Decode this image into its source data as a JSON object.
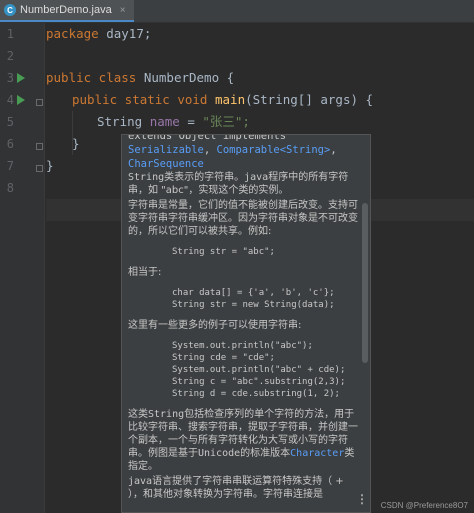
{
  "tab": {
    "title": "NumberDemo.java",
    "icon": "class-icon",
    "close": "×"
  },
  "gutter": {
    "line_numbers": [
      "1",
      "2",
      "3",
      "4",
      "5",
      "6",
      "7",
      "8"
    ]
  },
  "code": {
    "l1_kw": "package",
    "l1_rest": " day17;",
    "l3_kw": "public class",
    "l3_rest": " NumberDemo {",
    "l4_kw": "public static void",
    "l4_fn": "main",
    "l4_rest": "(String[] args) {",
    "l5_type": "String",
    "l5_var": "name",
    "l5_eq": " = ",
    "l5_str": "\"张三\";",
    "l6": "}",
    "l7": "}"
  },
  "doc": {
    "sig_line0": "extends Object implements",
    "sig_line1a": "Serializable",
    "sig_line1b": ", ",
    "sig_line1c": "Comparable<String>",
    "sig_line1d": ",",
    "sig_line2": "CharSequence",
    "p1a": "String",
    "p1b": "类表示的字符串。",
    "p1c": "java",
    "p1d": "程序中的所有字符串，如 \"abc\"，实现这个类的实例。",
    "p2": "字符串是常量，它们的值不能被创建后改变。支持可变字符串字符串缓冲区。因为字符串对象是不可改变的，所以它们可以被共享。例如:",
    "code1": "String str = \"abc\";",
    "p3": "相当于:",
    "code2": "char data[] = {'a', 'b', 'c'};\nString str = new String(data);",
    "p4": "这里有一些更多的例子可以使用字符串:",
    "code3": "System.out.println(\"abc\");\nString cde = \"cde\";\nSystem.out.println(\"abc\" + cde);\nString c = \"abc\".substring(2,3);\nString d = cde.substring(1, 2);",
    "p5a": "这类",
    "p5b": "String",
    "p5c": "包括检查序列的单个字符的方法，用于比较字符串、搜索字符串，提取子字符串，并创建一个副本，一个与所有字符转化为大写或小写的字符串。例图是基于",
    "p5d": "Unicode",
    "p5e": "的标准版本",
    "p5f": "Character",
    "p5g": "类指定。",
    "p6a": "java",
    "p6b": "语言提供了字符串串联运算符特殊支持（ + ），和其他对象转换为字符串。字符串连接是",
    "more": "⋮"
  },
  "watermark": "CSDN @Preference8O7",
  "colors": {
    "background": "#2b2b2b",
    "keyword": "#cc7832",
    "method": "#ffc66d",
    "variable": "#9876aa",
    "string": "#6a8759",
    "link": "#589df6",
    "popup": "#3c3f41"
  }
}
